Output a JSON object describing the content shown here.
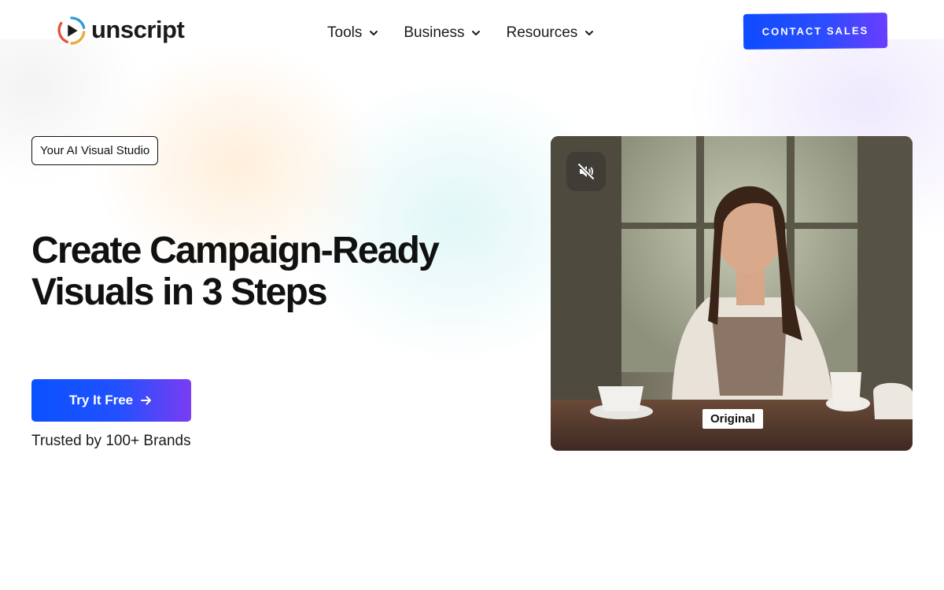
{
  "brand": {
    "name": "unscript",
    "logo_icon": "play-ring-icon"
  },
  "nav": {
    "items": [
      {
        "label": "Tools",
        "icon": "chevron-down-icon"
      },
      {
        "label": "Business",
        "icon": "chevron-down-icon"
      },
      {
        "label": "Resources",
        "icon": "chevron-down-icon"
      }
    ],
    "cta_label": "CONTACT SALES"
  },
  "hero": {
    "badge": "Your AI Visual Studio",
    "headline_line1": "Create Campaign-Ready",
    "headline_line2": "Visuals in 3 Steps",
    "primary_button": "Try It Free",
    "primary_button_icon": "arrow-right-icon",
    "trust_text": "Trusted by 100+ Brands"
  },
  "video": {
    "mute_icon": "volume-muted-icon",
    "tag": "Original"
  },
  "colors": {
    "accent_blue": "#0f4bff",
    "accent_purple": "#7a3cf2",
    "text": "#111111"
  }
}
